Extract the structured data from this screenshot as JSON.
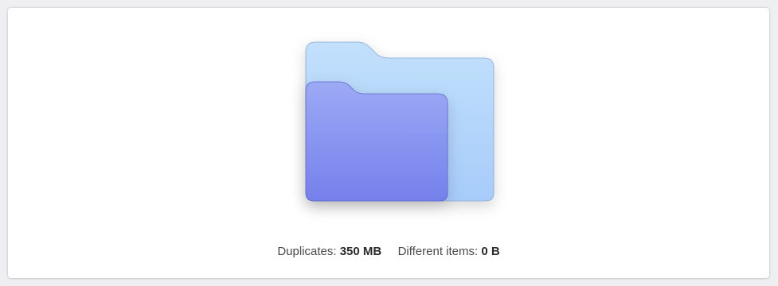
{
  "summary": {
    "duplicates_label": "Duplicates:",
    "duplicates_value": "350 MB",
    "different_label": "Different items:",
    "different_value": "0 B"
  },
  "illustration": {
    "icon": "folder-pair-icon",
    "back_folder_color": "#b3d6fb",
    "front_folder_color": "#8a97f0"
  }
}
